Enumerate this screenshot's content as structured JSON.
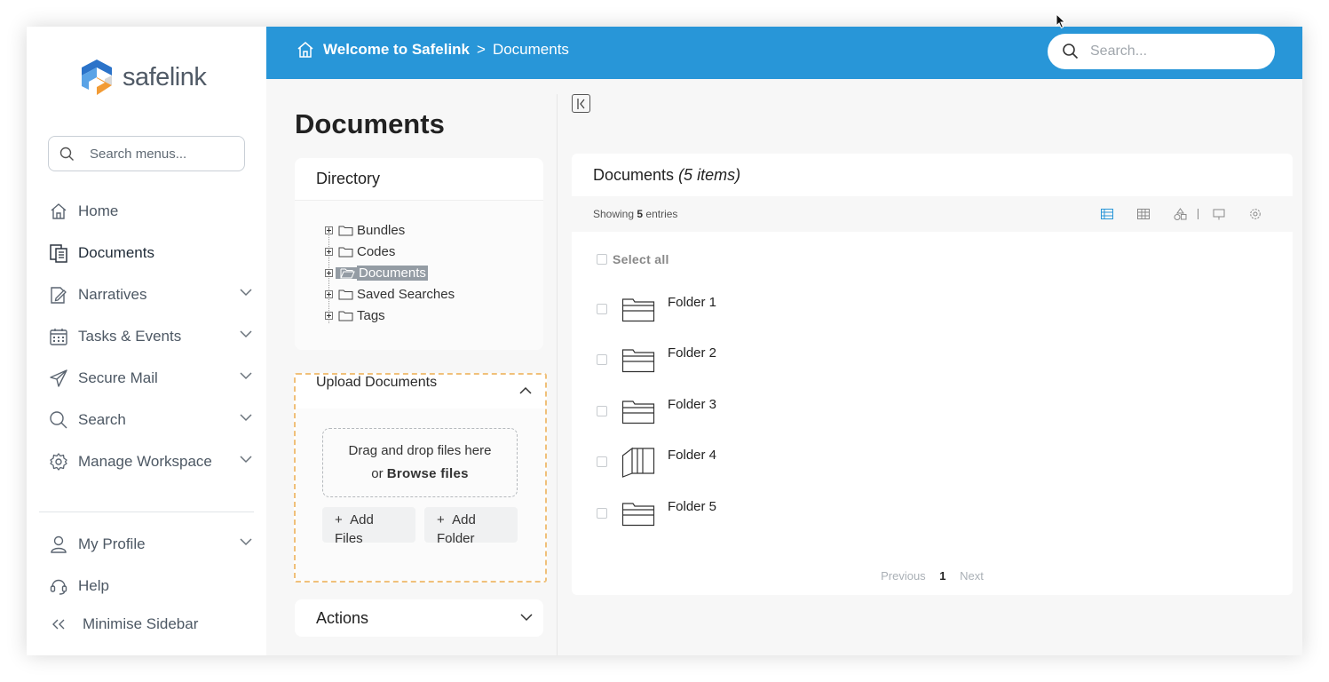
{
  "brand": {
    "name": "safelink",
    "colors": {
      "accent": "#2896d8",
      "logo_blue": "#2b73c9",
      "logo_orange": "#f29b35",
      "upload_border": "#f0c07a"
    }
  },
  "sidebar": {
    "search_placeholder": "Search menus...",
    "items": [
      {
        "label": "Home",
        "icon": "home-icon",
        "has_chevron": false
      },
      {
        "label": "Documents",
        "icon": "documents-icon",
        "has_chevron": false,
        "active": true
      },
      {
        "label": "Narratives",
        "icon": "narratives-icon",
        "has_chevron": true
      },
      {
        "label": "Tasks & Events",
        "icon": "calendar-icon",
        "has_chevron": true
      },
      {
        "label": "Secure Mail",
        "icon": "paper-plane-icon",
        "has_chevron": true
      },
      {
        "label": "Search",
        "icon": "search-icon",
        "has_chevron": true
      },
      {
        "label": "Manage Workspace",
        "icon": "gear-icon",
        "has_chevron": true
      }
    ],
    "bottom_items": [
      {
        "label": "My Profile",
        "icon": "user-icon",
        "has_chevron": true
      },
      {
        "label": "Help",
        "icon": "headset-icon",
        "has_chevron": false
      }
    ],
    "minimise_label": "Minimise Sidebar",
    "minimise_icon": "double-chevron-left-icon"
  },
  "header": {
    "breadcrumb_root": "Welcome to Safelink",
    "breadcrumb_sep": ">",
    "breadcrumb_current": "Documents",
    "search_placeholder": "Search..."
  },
  "page": {
    "title": "Documents"
  },
  "directory": {
    "title": "Directory",
    "tree": [
      {
        "label": "Bundles",
        "selected": false
      },
      {
        "label": "Codes",
        "selected": false
      },
      {
        "label": "Documents",
        "selected": true
      },
      {
        "label": "Saved Searches",
        "selected": false
      },
      {
        "label": "Tags",
        "selected": false
      }
    ]
  },
  "upload": {
    "title": "Upload Documents",
    "drop_line1": "Drag and drop files here",
    "drop_or": "or ",
    "drop_browse": "Browse files",
    "add_files_plus": "+",
    "add_files": "Add Files",
    "add_folder_plus": "+",
    "add_folder": "Add Folder"
  },
  "actions": {
    "title": "Actions"
  },
  "documents": {
    "title": "Documents",
    "count_label": "(5 items)",
    "showing_prefix": "Showing",
    "showing_count": "5",
    "showing_suffix": "entries",
    "select_all": "Select all",
    "files": [
      {
        "name": "Folder 1",
        "icon": "folder-closed-icon"
      },
      {
        "name": "Folder 2",
        "icon": "folder-closed-icon"
      },
      {
        "name": "Folder 3",
        "icon": "folder-closed-icon"
      },
      {
        "name": "Folder 4",
        "icon": "folder-open-icon"
      },
      {
        "name": "Folder 5",
        "icon": "folder-closed-icon"
      }
    ],
    "pager": {
      "previous": "Previous",
      "current": "1",
      "next": "Next"
    }
  }
}
